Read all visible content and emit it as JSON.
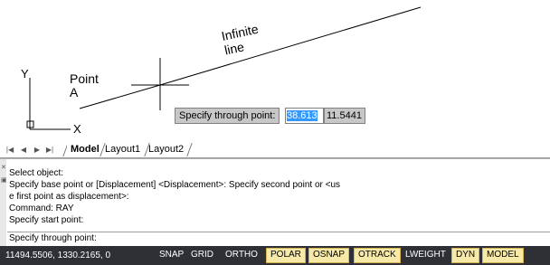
{
  "drawing": {
    "point_label_line1": "Point",
    "point_label_line2": "A",
    "line_label_line1": "Infinite",
    "line_label_line2": "line",
    "ucs_y_label": "Y",
    "ucs_x_label": "X"
  },
  "dynamic_input": {
    "prompt": "Specify through point:",
    "value1": "38.613",
    "value2": "11.5441"
  },
  "tabs": {
    "nav_first": "|◀",
    "nav_prev": "◀",
    "nav_next": "▶",
    "nav_last": "▶|",
    "model": "Model",
    "layout1": "Layout1",
    "layout2": "Layout2"
  },
  "command_window": {
    "history": [
      "Select object:",
      "Specify base point or [Displacement] <Displacement>: Specify second point or <us",
      "e first point as displacement>:",
      "Command: RAY",
      "Specify start point:"
    ],
    "current_prompt": "Specify through point:"
  },
  "status_bar": {
    "coordinates": "11494.5506, 1330.2165, 0",
    "snap": "SNAP",
    "grid": "GRID",
    "ortho": "ORTHO",
    "polar": "POLAR",
    "osnap": "OSNAP",
    "otrack": "OTRACK",
    "lweight": "LWEIGHT",
    "dyn": "DYN",
    "model": "MODEL"
  },
  "colors": {
    "status_bar_bg": "#2e3035",
    "toggle_on_bg": "#f7e9a8",
    "selection_blue": "#3399ff"
  }
}
